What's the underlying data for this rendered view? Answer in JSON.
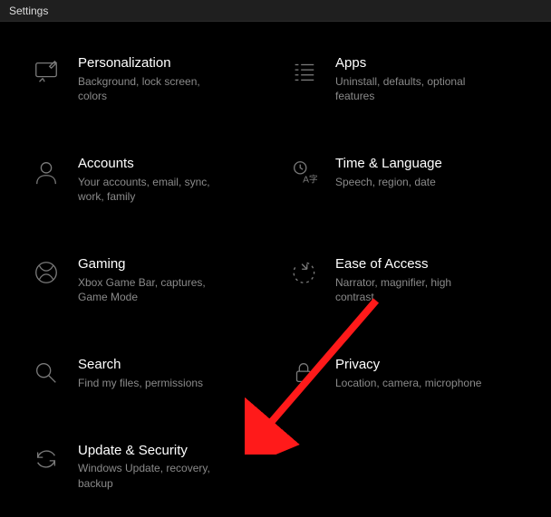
{
  "window": {
    "title": "Settings"
  },
  "items": [
    {
      "id": "personalization",
      "title": "Personalization",
      "subtitle": "Background, lock screen, colors"
    },
    {
      "id": "apps",
      "title": "Apps",
      "subtitle": "Uninstall, defaults, optional features"
    },
    {
      "id": "accounts",
      "title": "Accounts",
      "subtitle": "Your accounts, email, sync, work, family"
    },
    {
      "id": "time-language",
      "title": "Time & Language",
      "subtitle": "Speech, region, date"
    },
    {
      "id": "gaming",
      "title": "Gaming",
      "subtitle": "Xbox Game Bar, captures, Game Mode"
    },
    {
      "id": "ease-of-access",
      "title": "Ease of Access",
      "subtitle": "Narrator, magnifier, high contrast"
    },
    {
      "id": "search",
      "title": "Search",
      "subtitle": "Find my files, permissions"
    },
    {
      "id": "privacy",
      "title": "Privacy",
      "subtitle": "Location, camera, microphone"
    },
    {
      "id": "update-security",
      "title": "Update & Security",
      "subtitle": "Windows Update, recovery, backup"
    }
  ]
}
